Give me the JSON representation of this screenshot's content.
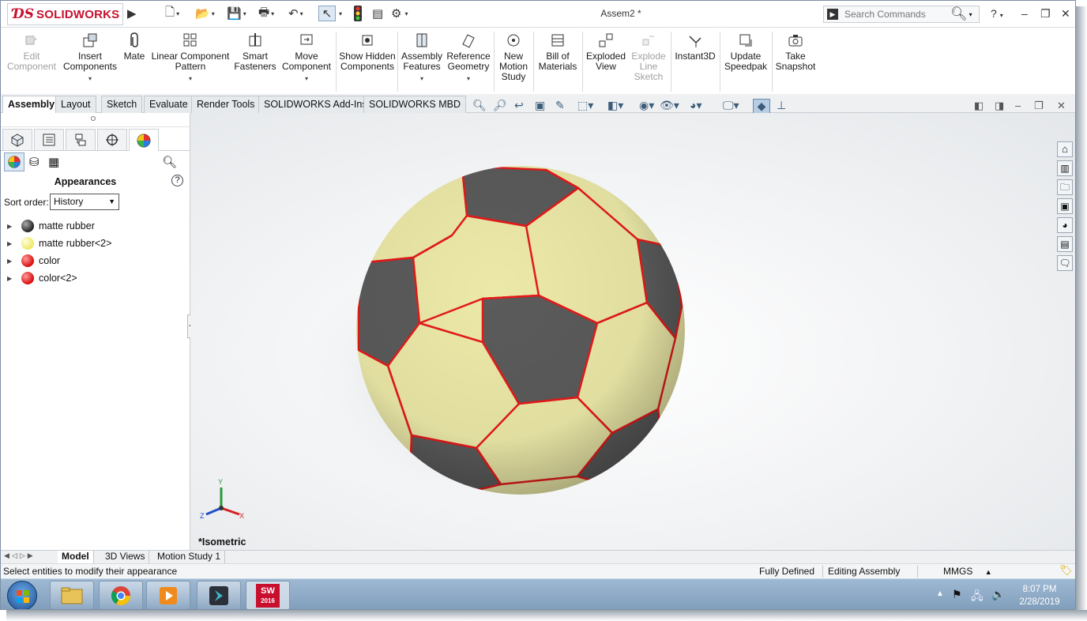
{
  "titlebar": {
    "brand": "SOLIDWORKS",
    "document_title": "Assem2 *",
    "search_placeholder": "Search Commands",
    "help": "?"
  },
  "command_manager": {
    "buttons": [
      {
        "label": "Edit Component",
        "enabled": false
      },
      {
        "label": "Insert Components",
        "enabled": true
      },
      {
        "label": "Mate",
        "enabled": true
      },
      {
        "label": "Linear Component Pattern",
        "enabled": true
      },
      {
        "label": "Smart Fasteners",
        "enabled": true
      },
      {
        "label": "Move Component",
        "enabled": true
      },
      {
        "label": "Show Hidden Components",
        "enabled": true
      },
      {
        "label": "Assembly Features",
        "enabled": true
      },
      {
        "label": "Reference Geometry",
        "enabled": true
      },
      {
        "label": "New Motion Study",
        "enabled": true
      },
      {
        "label": "Bill of Materials",
        "enabled": true
      },
      {
        "label": "Exploded View",
        "enabled": true
      },
      {
        "label": "Explode Line Sketch",
        "enabled": false
      },
      {
        "label": "Instant3D",
        "enabled": true
      },
      {
        "label": "Update Speedpak",
        "enabled": true
      },
      {
        "label": "Take Snapshot",
        "enabled": true
      }
    ]
  },
  "tabs": [
    "Assembly",
    "Layout",
    "Sketch",
    "Evaluate",
    "Render Tools",
    "SOLIDWORKS Add-Ins",
    "SOLIDWORKS MBD"
  ],
  "active_tab": "Assembly",
  "left_panel": {
    "title": "Appearances",
    "sort_label": "Sort order:",
    "sort_value": "History",
    "items": [
      {
        "label": "matte rubber",
        "color": "#3a3a3a"
      },
      {
        "label": "matte rubber<2>",
        "color": "#f3ef6a"
      },
      {
        "label": "color",
        "color": "#e01010"
      },
      {
        "label": "color<2>",
        "color": "#e01010"
      }
    ]
  },
  "viewport": {
    "view_label": "*Isometric",
    "triad": {
      "x": "X",
      "y": "Y",
      "z": "Z"
    }
  },
  "bottom_tabs": [
    "Model",
    "3D Views",
    "Motion Study 1"
  ],
  "active_bottom_tab": "Model",
  "status": {
    "message": "Select entities to modify their appearance",
    "state": "Fully Defined",
    "mode": "Editing Assembly",
    "units": "MMGS"
  },
  "taskbar": {
    "time": "8:07 PM",
    "date": "2/28/2019",
    "sw_badge": "2016"
  },
  "colors": {
    "brand": "#c8102e",
    "ball_panel_light": "#ece9a8",
    "ball_panel_dark": "#5b5b5b",
    "seam": "#e51a1a"
  }
}
